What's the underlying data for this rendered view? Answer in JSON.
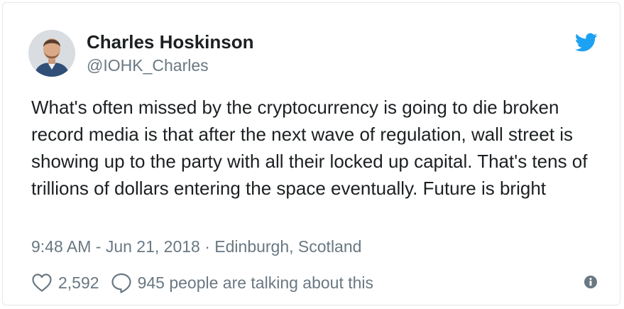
{
  "tweet": {
    "author_name": "Charles Hoskinson",
    "author_handle": "@IOHK_Charles",
    "body": "What's often missed by the cryptocurrency is going to die broken record media is that after the next wave of regulation, wall street is showing up to the party with all their locked up capital. That's tens of trillions of dollars entering the space eventually. Future is bright",
    "time": "9:48 AM - Jun 21, 2018",
    "separator": " · ",
    "location": "Edinburgh, Scotland",
    "likes": "2,592",
    "talking": "945 people are talking about this"
  },
  "colors": {
    "twitter_blue": "#1da1f2",
    "text_primary": "#1c2022",
    "text_secondary": "#697882",
    "border": "#e1e8ed"
  },
  "icons": {
    "brand": "twitter-bird-icon",
    "like": "heart-icon",
    "reply": "speech-bubble-icon",
    "info": "info-icon"
  }
}
